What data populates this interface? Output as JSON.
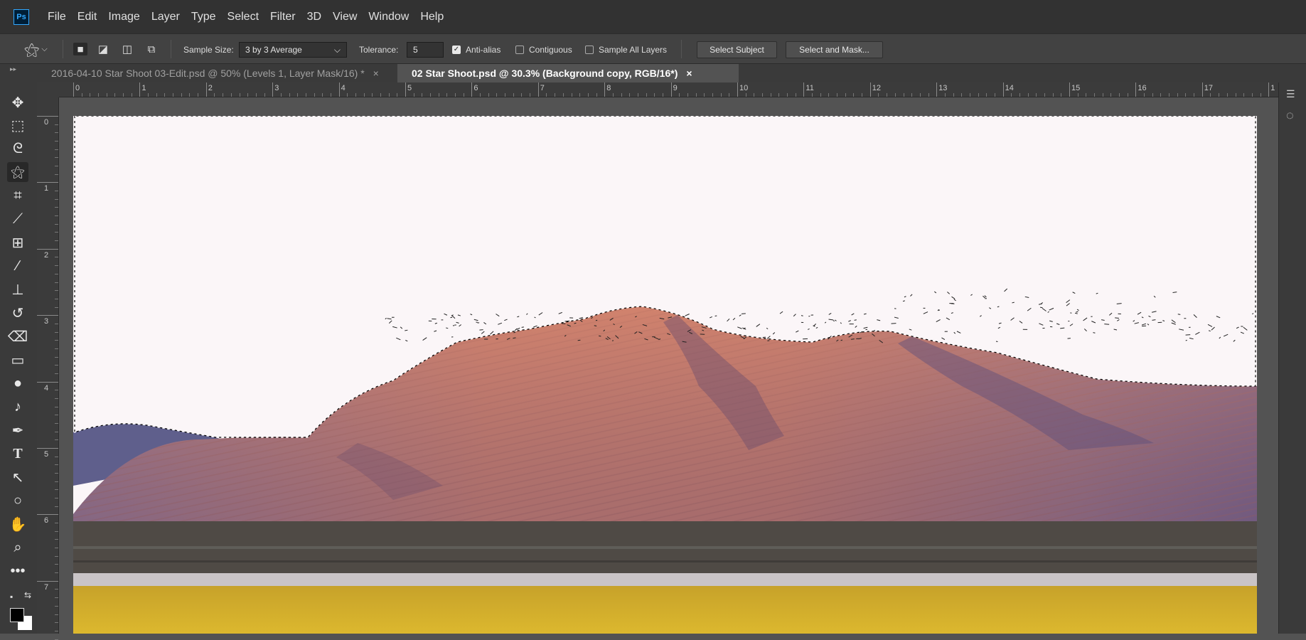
{
  "app": {
    "logo": "Ps"
  },
  "menu": [
    "File",
    "Edit",
    "Image",
    "Layer",
    "Type",
    "Select",
    "Filter",
    "3D",
    "View",
    "Window",
    "Help"
  ],
  "options": {
    "tool_icon": "magic-wand-icon",
    "sample_size_label": "Sample Size:",
    "sample_size_value": "3 by 3 Average",
    "tolerance_label": "Tolerance:",
    "tolerance_value": "5",
    "anti_alias_label": "Anti-alias",
    "anti_alias_checked": true,
    "contiguous_label": "Contiguous",
    "contiguous_checked": false,
    "sample_all_layers_label": "Sample All Layers",
    "sample_all_layers_checked": false,
    "select_subject_label": "Select Subject",
    "select_and_mask_label": "Select and Mask..."
  },
  "tabs": [
    {
      "label": "2016-04-10 Star Shoot 03-Edit.psd @ 50% (Levels 1, Layer Mask/16) *",
      "active": false
    },
    {
      "label": "02 Star Shoot.psd @ 30.3% (Background copy, RGB/16*)",
      "active": true
    }
  ],
  "tab_close_glyph": "×",
  "ruler": {
    "top_labels": [
      "0",
      "1",
      "2",
      "3",
      "4",
      "5",
      "6",
      "7",
      "8",
      "9",
      "10",
      "11",
      "12",
      "13",
      "14",
      "15",
      "16",
      "17",
      "1"
    ],
    "left_labels": [
      "0",
      "1",
      "2",
      "3",
      "4",
      "5",
      "6",
      "7"
    ]
  },
  "tools": [
    "move-tool-icon",
    "marquee-tool-icon",
    "lasso-tool-icon",
    "magic-wand-tool-icon",
    "crop-tool-icon",
    "eyedropper-tool-icon",
    "patch-tool-icon",
    "brush-tool-icon",
    "stamp-tool-icon",
    "history-brush-tool-icon",
    "eraser-tool-icon",
    "gradient-tool-icon",
    "blur-tool-icon",
    "dodge-tool-icon",
    "pen-tool-icon",
    "type-tool-icon",
    "path-select-tool-icon",
    "ellipse-tool-icon",
    "hand-tool-icon",
    "zoom-tool-icon",
    "more-tools-icon"
  ],
  "colors": {
    "foreground": "#000000",
    "background": "#ffffff",
    "sky": "#fbf6f8",
    "mountain_light": "#c97a66",
    "mountain_shadow": "#6b5a86",
    "field_dark": "#4f4a45",
    "road": "#c9c4c6",
    "flowers": "#d7b42a"
  }
}
